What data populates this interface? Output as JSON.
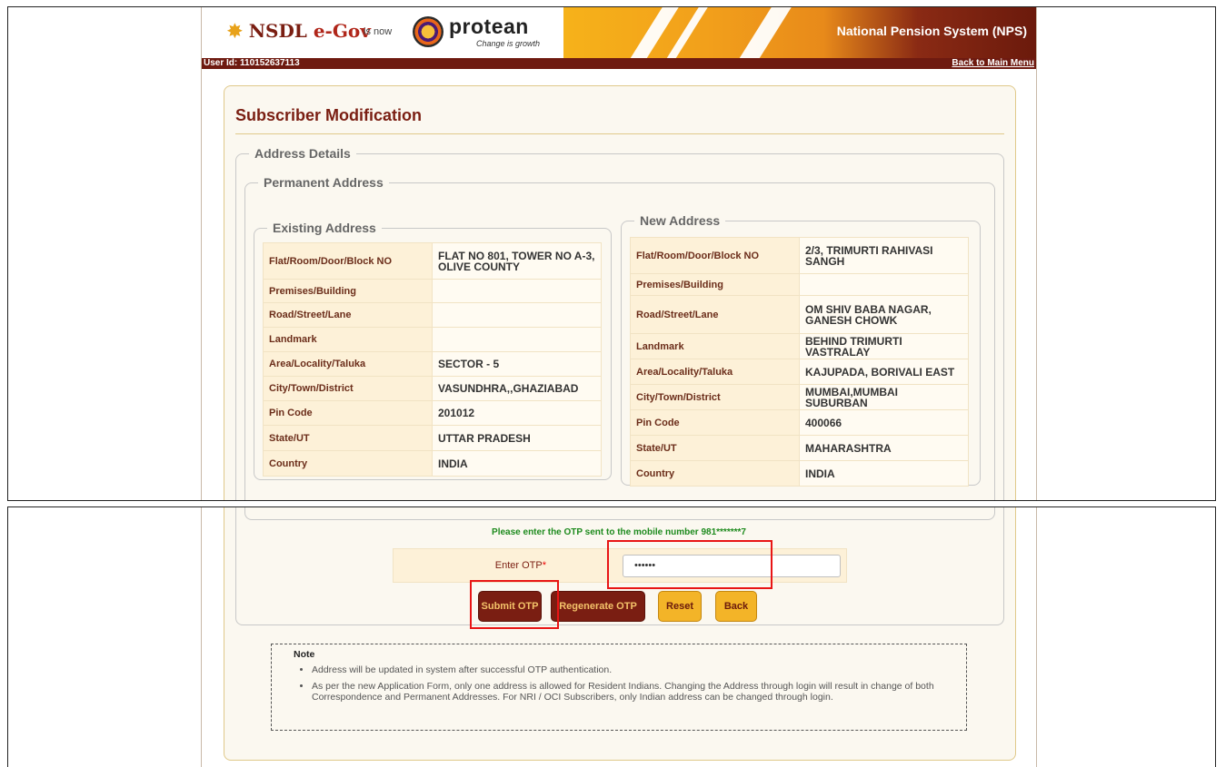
{
  "header": {
    "brand_nsdl": "NSDL ",
    "brand_egov": "e-Gov",
    "is_now": "is now",
    "brand_protean": "protean",
    "tagline": "Change is growth",
    "system_title": "National Pension System (NPS)",
    "user_id": "User Id: 110152637113",
    "back_main": "Back to Main Menu"
  },
  "page": {
    "title": "Subscriber Modification",
    "address_details": "Address Details",
    "permanent_address": "Permanent Address",
    "existing_address": "Existing Address",
    "new_address": "New Address"
  },
  "existing": [
    {
      "label": "Flat/Room/Door/Block NO",
      "value": "FLAT NO 801, TOWER NO A-3, OLIVE COUNTY"
    },
    {
      "label": "Premises/Building",
      "value": ""
    },
    {
      "label": "Road/Street/Lane",
      "value": ""
    },
    {
      "label": "Landmark",
      "value": ""
    },
    {
      "label": "Area/Locality/Taluka",
      "value": "SECTOR - 5"
    },
    {
      "label": "City/Town/District",
      "value": "VASUNDHRA,,GHAZIABAD"
    },
    {
      "label": "Pin Code",
      "value": "201012"
    },
    {
      "label": "State/UT",
      "value": "UTTAR PRADESH"
    },
    {
      "label": "Country",
      "value": "INDIA"
    }
  ],
  "new": [
    {
      "label": "Flat/Room/Door/Block NO",
      "value": "2/3, TRIMURTI RAHIVASI SANGH"
    },
    {
      "label": "Premises/Building",
      "value": ""
    },
    {
      "label": "Road/Street/Lane",
      "value": "OM SHIV BABA NAGAR, GANESH CHOWK"
    },
    {
      "label": "Landmark",
      "value": "BEHIND TRIMURTI VASTRALAY"
    },
    {
      "label": "Area/Locality/Taluka",
      "value": "KAJUPADA, BORIVALI EAST"
    },
    {
      "label": "City/Town/District",
      "value": "MUMBAI,MUMBAI SUBURBAN"
    },
    {
      "label": "Pin Code",
      "value": "400066"
    },
    {
      "label": "State/UT",
      "value": "MAHARASHTRA"
    },
    {
      "label": "Country",
      "value": "INDIA"
    }
  ],
  "otp": {
    "message": "Please enter the OTP sent to the mobile number 981*******7",
    "label": "Enter OTP",
    "required_mark": "*",
    "value": "••••••"
  },
  "buttons": {
    "submit": "Submit OTP",
    "regenerate": "Regenerate OTP",
    "reset": "Reset",
    "back": "Back"
  },
  "note": {
    "heading": "Note",
    "items": [
      "Address will be updated in system after successful OTP authentication.",
      "As per the new Application Form, only one address is allowed for Resident Indians. Changing the Address through login will result in change of both Correspondence and Permanent Addresses. For NRI / OCI Subscribers, only Indian address can be changed through login."
    ]
  }
}
